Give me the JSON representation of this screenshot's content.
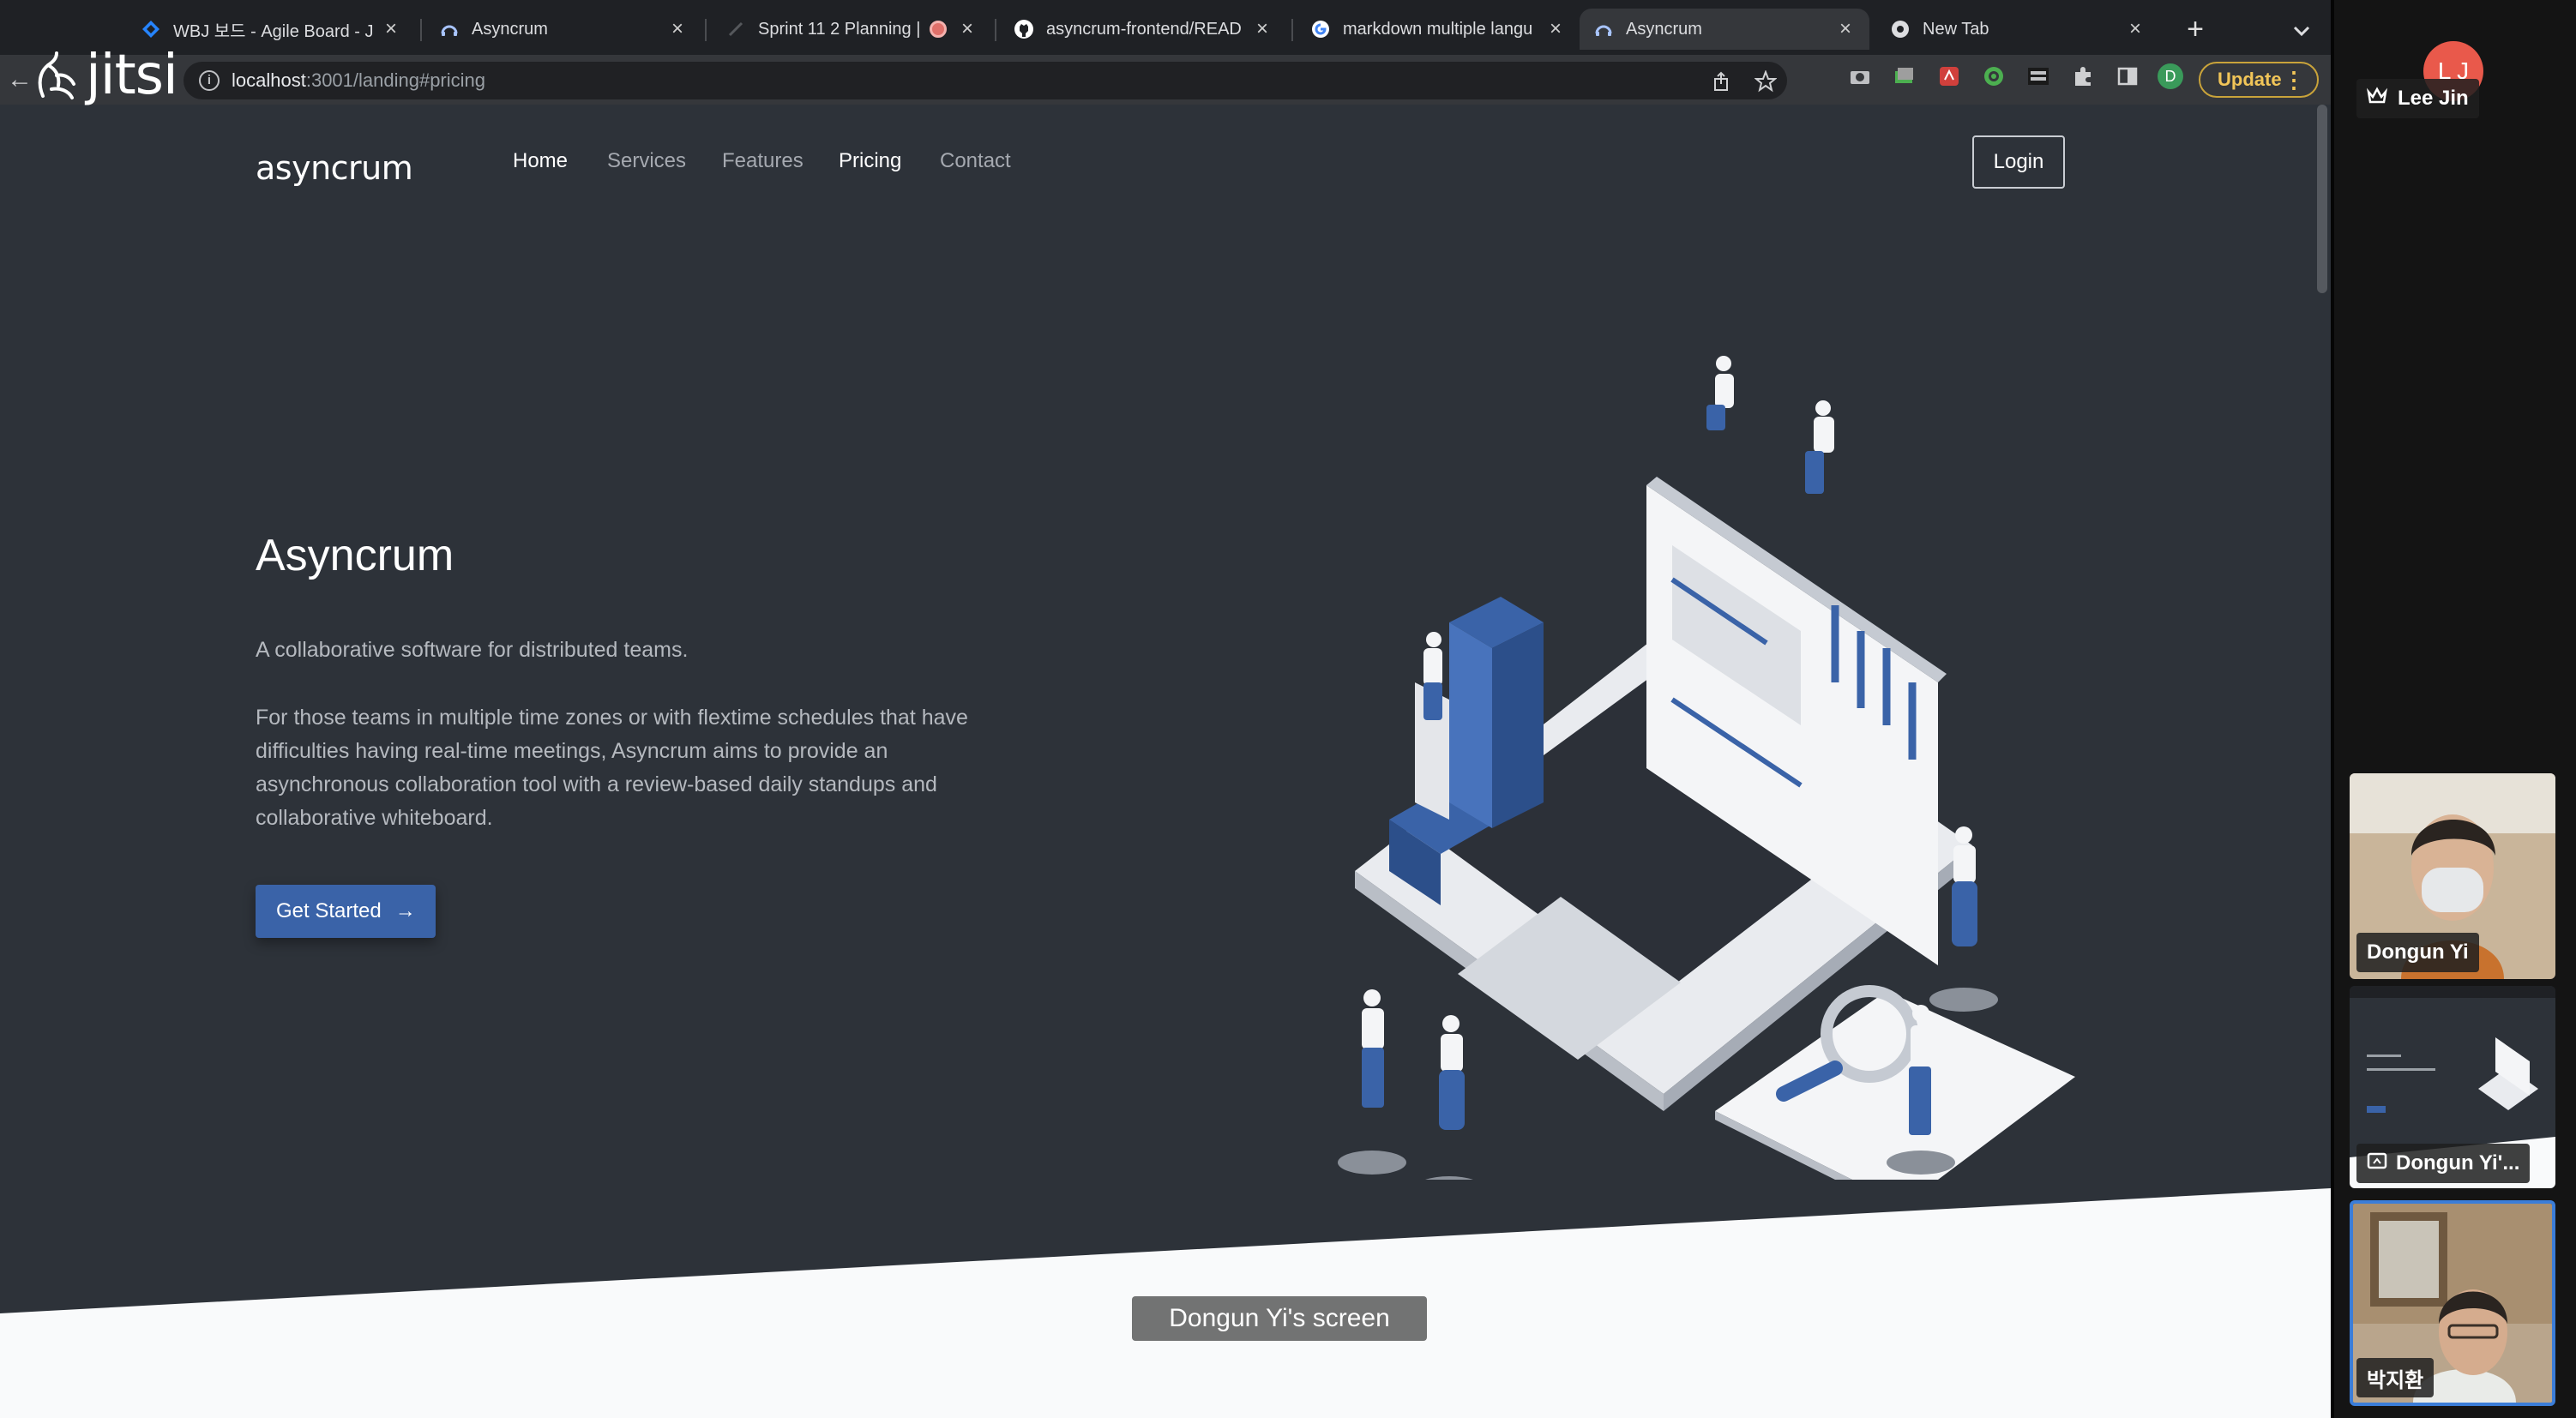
{
  "browser": {
    "tabs": [
      {
        "title": "WBJ 보드 - Agile Board - J",
        "icon": "jira-diamond-icon",
        "active": false
      },
      {
        "title": "Asyncrum",
        "icon": "asyncrum-icon",
        "active": false
      },
      {
        "title": "Sprint 11 2 Planning |",
        "icon": "recording-icon",
        "active": false
      },
      {
        "title": "asyncrum-frontend/READ",
        "icon": "github-icon",
        "active": false
      },
      {
        "title": "markdown multiple langu",
        "icon": "google-icon",
        "active": false
      },
      {
        "title": "Asyncrum",
        "icon": "asyncrum-icon",
        "active": true
      },
      {
        "title": "New Tab",
        "icon": "chrome-icon",
        "active": false
      }
    ],
    "new_tab_glyph": "+",
    "url_host": "localhost",
    "url_rest": ":3001/landing#pricing",
    "profile_initial": "D",
    "update_label": "Update"
  },
  "jitsi": {
    "brand": "jitsi",
    "screen_caption": "Dongun Yi's screen",
    "local_initials": "L J",
    "participants": [
      {
        "name": "Lee Jin",
        "moderator": true
      },
      {
        "name": "Dongun Yi",
        "kind": "camera"
      },
      {
        "name": "Dongun Yi'...",
        "kind": "screenshare"
      },
      {
        "name": "박지환",
        "kind": "camera",
        "active_speaker": true
      }
    ]
  },
  "site": {
    "logo": "asyncrum",
    "nav": [
      "Home",
      "Services",
      "Features",
      "Pricing",
      "Contact"
    ],
    "login_label": "Login",
    "hero_title": "Asyncrum",
    "hero_subtitle": "A collaborative software for distributed teams.",
    "hero_body": "For those teams in multiple time zones or with flextime schedules that have difficulties having real-time meetings, Asyncrum aims to provide an asynchronous collaboration tool with a review-based daily standups and collaborative whiteboard.",
    "cta_label": "Get Started",
    "cta_arrow": "→"
  },
  "colors": {
    "page_bg": "#2d3239",
    "cta_blue": "#3a63a8",
    "tab_strip": "#1f2125",
    "active_speaker_border": "#3b7dd8"
  }
}
